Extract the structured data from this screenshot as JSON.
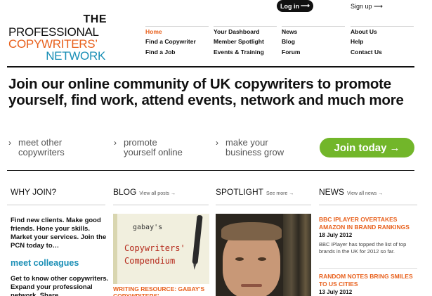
{
  "logo": {
    "line1": "THE",
    "line2": "PROFESSIONAL",
    "line3": "COPYWRITERS’",
    "line4": "NETWORK"
  },
  "topbar": {
    "login_label": "Log in",
    "login_arrow": "⟶",
    "signup_label": "Sign up",
    "signup_arrow": "⟶"
  },
  "nav": {
    "col1": [
      "Home",
      "Find a Copywriter",
      "Find a Job"
    ],
    "col2": [
      "Your Dashboard",
      "Member Spotlight",
      "Events & Training"
    ],
    "col3": [
      "News",
      "Blog",
      "Forum"
    ],
    "col4": [
      "About Us",
      "Help",
      "Contact Us"
    ],
    "active": "Home"
  },
  "hero": {
    "headline": "Join our online community of UK copywriters to promote yourself, find work, attend events, network and much more",
    "benefits": [
      {
        "line1": "meet other",
        "line2": "copywriters"
      },
      {
        "line1": "promote",
        "line2": "yourself online"
      },
      {
        "line1": "make your",
        "line2": "business grow"
      }
    ],
    "chevron": "›",
    "join_label": "Join today",
    "join_arrow": "→"
  },
  "sections": {
    "why": {
      "title": "WHY JOIN?"
    },
    "blog": {
      "title": "BLOG",
      "link": "View all posts →"
    },
    "spotlight": {
      "title": "SPOTLIGHT",
      "link": "See more →"
    },
    "news": {
      "title": "NEWS",
      "link": "View all news →"
    }
  },
  "why_join": {
    "intro": "Find new clients. Make good friends. Hone your skills. Market your services. Join the PCN today to…",
    "highlight": "meet colleagues",
    "body": "Get to know other copywriters. Expand your professional network. Share"
  },
  "blog": {
    "image_text": {
      "top": "gabay's",
      "title1": "Copywriters'",
      "title2": "Compendium"
    },
    "post_title": "WRITING RESOURCE: GABAY'S COPYWRITERS'"
  },
  "news": [
    {
      "title": "BBC IPLAYER OVERTAKES AMAZON IN BRAND RANKINGS",
      "date": "18 July 2012",
      "excerpt": "BBC iPlayer has topped the list of top brands in the UK for 2012 so far."
    },
    {
      "title": "RANDOM NOTES BRING SMILES TO US CITIES",
      "date": "13 July 2012"
    }
  ],
  "colors": {
    "accent_orange": "#e8601c",
    "accent_blue": "#1a8fb6",
    "join_green": "#72b62a",
    "dark": "#111111"
  }
}
